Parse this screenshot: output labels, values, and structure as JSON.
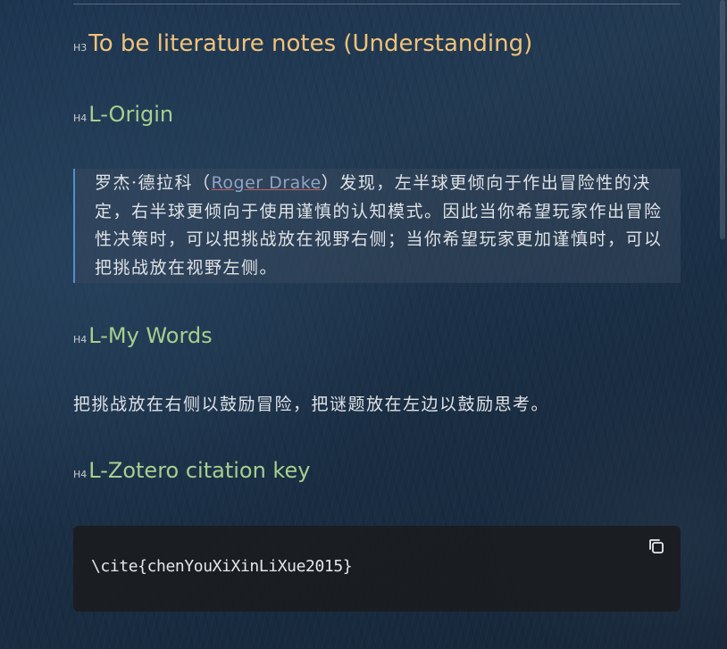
{
  "note": {
    "section_heading": {
      "tag": "H3",
      "text": "To be literature notes (Understanding)"
    },
    "origin": {
      "tag": "H4",
      "heading": "L-Origin",
      "quote_prefix": "罗杰·德拉科（",
      "quote_link": "Roger Drake",
      "quote_suffix": "）发现，左半球更倾向于作出冒险性的决定，右半球更倾向于使用谨慎的认知模式。因此当你希望玩家作出冒险性决策时，可以把挑战放在视野右侧；当你希望玩家更加谨慎时，可以把挑战放在视野左侧。"
    },
    "my_words": {
      "tag": "H4",
      "heading": "L-My Words",
      "text": "把挑战放在右侧以鼓励冒险，把谜题放在左边以鼓励思考。"
    },
    "zotero": {
      "tag": "H4",
      "heading": "L-Zotero citation key",
      "code": "\\cite{chenYouXiXinLiXue2015}",
      "copy_icon": "copy-icon"
    }
  },
  "colors": {
    "h3": "#f0c27a",
    "h4": "#a6d08e",
    "quote_border": "#4f8fd1",
    "code_bg": "#1a1c20"
  }
}
